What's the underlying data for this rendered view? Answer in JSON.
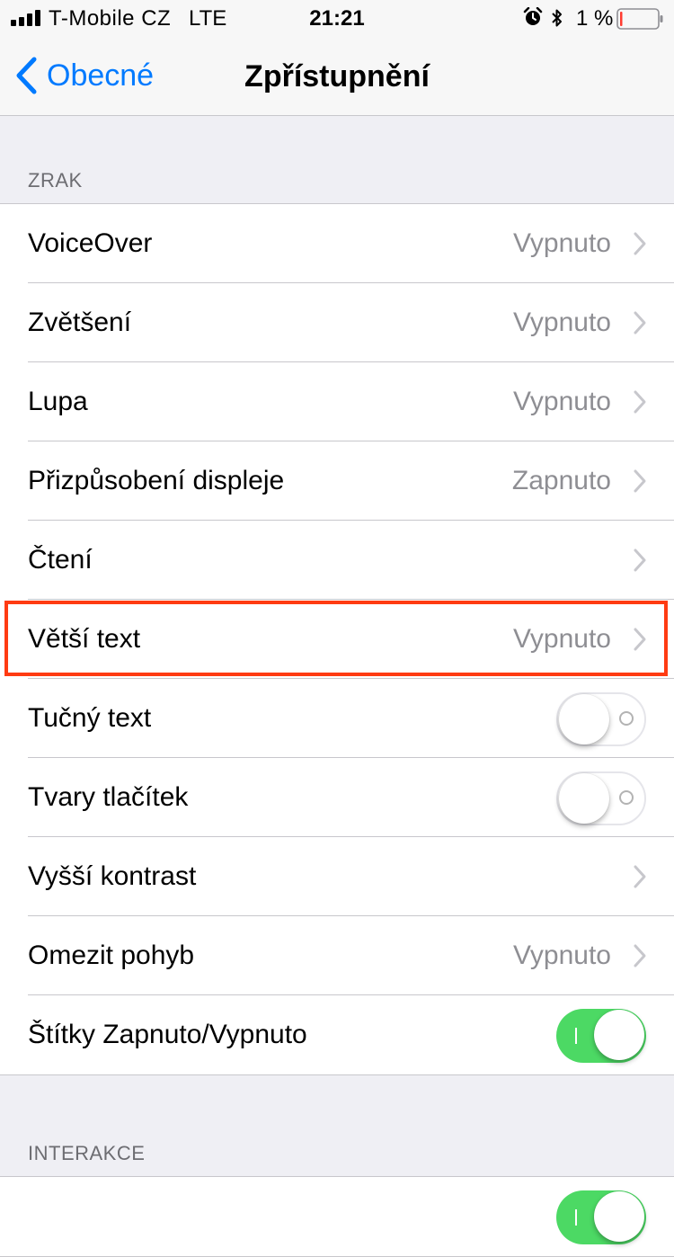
{
  "status_bar": {
    "carrier": "T-Mobile CZ",
    "network": "LTE",
    "time": "21:21",
    "battery_percent": "1 %",
    "icons": [
      "signal-icon",
      "alarm-icon",
      "bluetooth-icon",
      "battery-icon"
    ],
    "battery_color": "#ff3b30"
  },
  "nav": {
    "back_label": "Obecné",
    "title": "Zpřístupnění",
    "accent_color": "#007aff"
  },
  "sections": {
    "vision_header": "ZRAK",
    "interaction_header": "INTERAKCE"
  },
  "vision_rows": [
    {
      "label": "VoiceOver",
      "value": "Vypnuto"
    },
    {
      "label": "Zvětšení",
      "value": "Vypnuto"
    },
    {
      "label": "Lupa",
      "value": "Vypnuto"
    },
    {
      "label": "Přizpůsobení displeje",
      "value": "Zapnuto"
    },
    {
      "label": "Čtení",
      "value": ""
    },
    {
      "label": "Větší text",
      "value": "Vypnuto"
    },
    {
      "label": "Tučný text",
      "toggle": "off"
    },
    {
      "label": "Tvary tlačítek",
      "toggle": "off"
    },
    {
      "label": "Vyšší kontrast",
      "value": ""
    },
    {
      "label": "Omezit pohyb",
      "value": "Vypnuto"
    },
    {
      "label": "Štítky Zapnuto/Vypnuto",
      "toggle": "on"
    }
  ],
  "interaction_rows": [
    {
      "label": "",
      "toggle": "on"
    }
  ],
  "colors": {
    "toggle_on": "#4cd964",
    "highlight": "#ff3b12"
  }
}
